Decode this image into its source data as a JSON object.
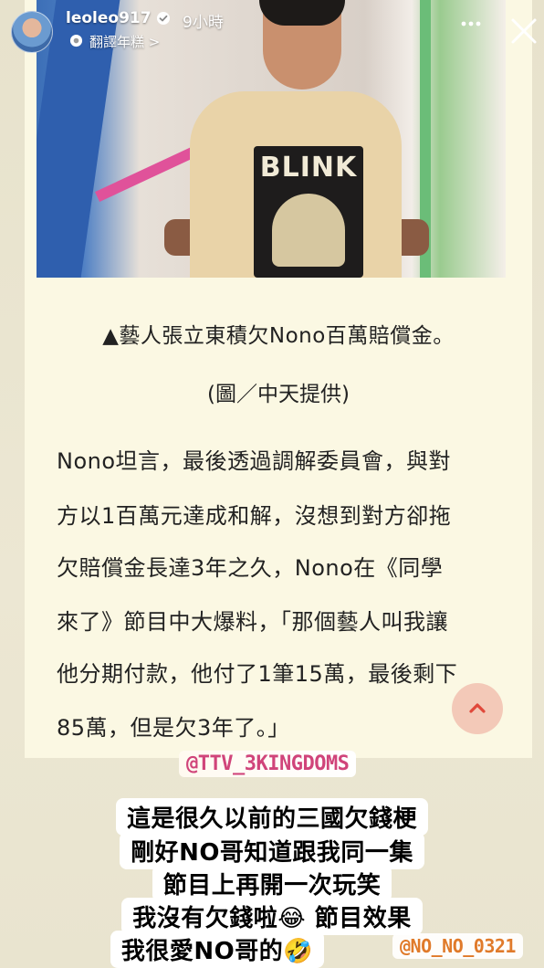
{
  "header": {
    "username": "leoleo917",
    "time": "9小時",
    "translate_label": "翻譯年糕 >"
  },
  "article": {
    "photo_print_text": "BLINK",
    "caption": "▲藝人張立東積欠Nono百萬賠償金。",
    "credit": "(圖／中天提供)",
    "body_lines": [
      "Nono坦言，最後透過調解委員會，與對",
      "方以1百萬元達成和解，沒想到對方卻拖",
      "欠賠償金長達3年之久，Nono在《同學",
      "來了》節目中大爆料，「那個藝人叫我讓",
      "他分期付款，他付了1筆15萬，最後剩下",
      "85萬，但是欠3年了。」"
    ]
  },
  "overlays": {
    "mention_top": "@TTV_3KINGDOMS",
    "lines": [
      "這是很久以前的三國欠錢梗",
      "剛好NO哥知道跟我同一集",
      "節目上再開一次玩笑",
      "我沒有欠錢啦😂 節目效果",
      "我很愛NO哥的🤣"
    ],
    "mention_bottom": "@NO_NO_0321"
  },
  "icons": {
    "verified": "verified-badge-icon",
    "translate": "translate-icon",
    "more": "more-options-icon",
    "close": "close-icon",
    "scroll_top": "chevron-up-icon"
  },
  "colors": {
    "card_bg": "#fbf8e3",
    "scroll_button": "#f3c9b8",
    "chevron": "#e0483a",
    "mention_top": "#d0447a",
    "mention_bottom": "#e07a2a"
  }
}
